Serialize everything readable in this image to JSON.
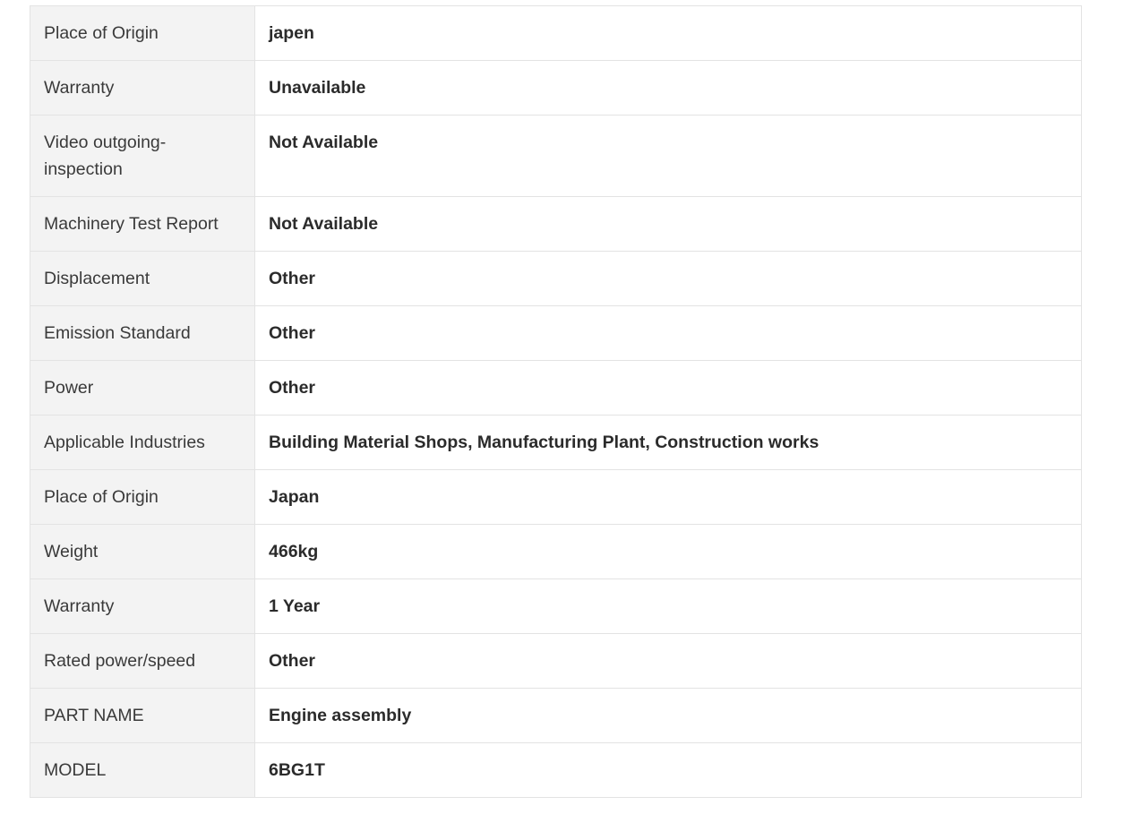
{
  "specs": [
    {
      "label": "Place of Origin",
      "value": "japen"
    },
    {
      "label": "Warranty",
      "value": "Unavailable"
    },
    {
      "label": "Video outgoing-inspection",
      "value": "Not Available"
    },
    {
      "label": "Machinery Test Report",
      "value": "Not Available"
    },
    {
      "label": "Displacement",
      "value": "Other"
    },
    {
      "label": "Emission Standard",
      "value": "Other"
    },
    {
      "label": "Power",
      "value": "Other"
    },
    {
      "label": "Applicable Industries",
      "value": "Building Material Shops, Manufacturing Plant, Construction works"
    },
    {
      "label": "Place of Origin",
      "value": "Japan"
    },
    {
      "label": "Weight",
      "value": "466kg"
    },
    {
      "label": "Warranty",
      "value": "1 Year"
    },
    {
      "label": "Rated power/speed",
      "value": "Other"
    },
    {
      "label": "PART NAME",
      "value": "Engine assembly"
    },
    {
      "label": "MODEL",
      "value": "6BG1T"
    }
  ],
  "colors": {
    "label_background": "#f3f3f3",
    "border": "#e3e3e3",
    "text": "#333333"
  }
}
